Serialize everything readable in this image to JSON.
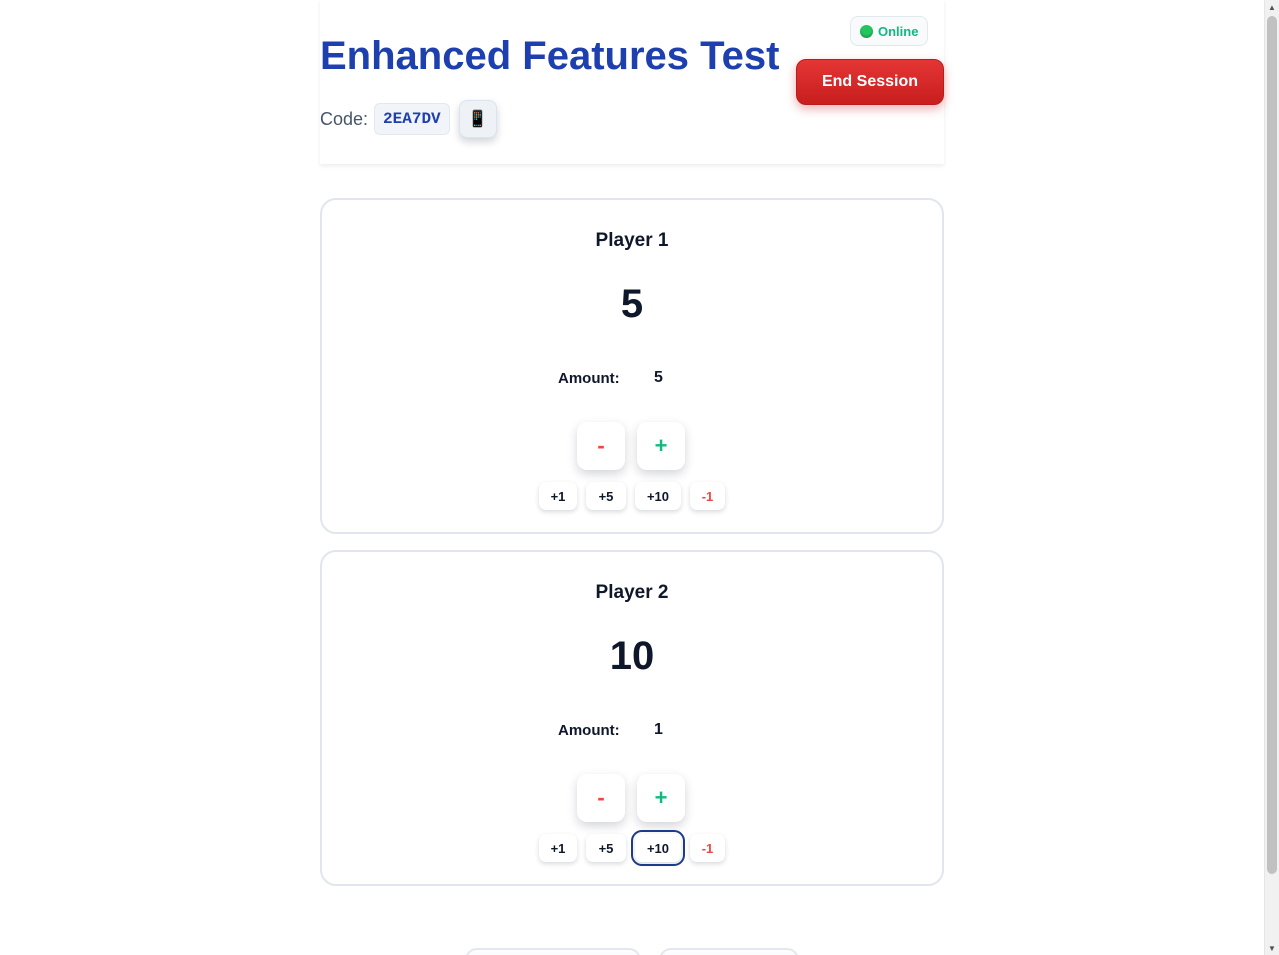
{
  "header": {
    "title": "Enhanced Features Test",
    "code_label": "Code:",
    "code_value": "2EA7DV",
    "qr_icon": "📱",
    "status": "Online",
    "status_color": "#22c55e",
    "end_button": "End Session"
  },
  "players": [
    {
      "name": "Player 1",
      "score": "5",
      "amount_label": "Amount:",
      "amount": "5",
      "minus": "-",
      "plus": "+",
      "quick": [
        "+1",
        "+5",
        "+10",
        "-1"
      ]
    },
    {
      "name": "Player 2",
      "score": "10",
      "amount_label": "Amount:",
      "amount": "1",
      "minus": "-",
      "plus": "+",
      "quick": [
        "+1",
        "+5",
        "+10",
        "-1"
      ]
    }
  ],
  "colors": {
    "accent": "#1e40af",
    "danger": "#dc2626",
    "success": "#10b981"
  }
}
